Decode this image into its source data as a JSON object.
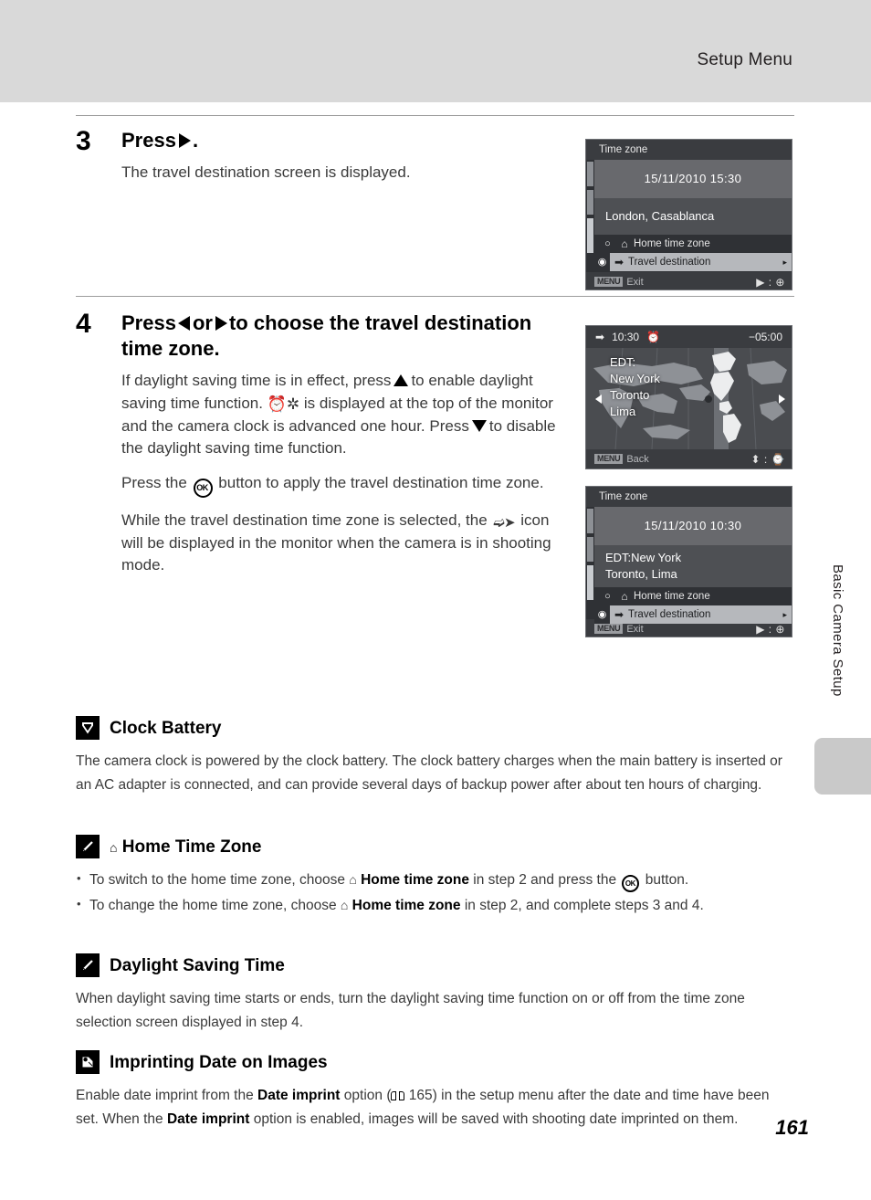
{
  "header": {
    "title": "Setup Menu"
  },
  "side_tab": {
    "label": "Basic Camera Setup"
  },
  "page_number": "161",
  "steps": [
    {
      "number": "3",
      "heading_prefix": "Press",
      "heading_suffix": ".",
      "paragraphs": [
        "The travel destination screen is displayed."
      ]
    },
    {
      "number": "4",
      "heading_part_1": "Press",
      "heading_part_2": "or",
      "heading_part_3": "to choose the travel destination time zone.",
      "para_1_a": "If daylight saving time is in effect, press",
      "para_1_b": "to enable daylight saving time function.",
      "para_1_c": "is displayed at the top of the monitor and the camera clock is advanced one hour. Press",
      "para_1_d": "to disable the daylight saving time function.",
      "para_2_a": "Press the",
      "para_2_b": "button to apply the travel destination time zone.",
      "para_3_a": "While the travel destination time zone is selected, the",
      "para_3_b": "icon will be displayed in the monitor when the camera is in shooting mode."
    }
  ],
  "lcd_screens": [
    {
      "title": "Time zone",
      "date": "15/11/2010 15:30",
      "city_lines": [
        "London, Casablanca"
      ],
      "options": [
        {
          "radio": "○",
          "icon": "home-icon",
          "label": "Home time zone",
          "selected": false
        },
        {
          "radio": "◉",
          "icon": "airplane-icon",
          "label": "Travel destination",
          "selected": true
        }
      ],
      "bottom_left_badge": "MENU",
      "bottom_left_label": "Exit",
      "bottom_right": "▶ : ⊕"
    },
    {
      "top_left_icon": "airplane-icon",
      "time": "10:30",
      "dst_icon": "daylight-saving-icon",
      "utc_offset": "−05:00",
      "labels": [
        "EDT:",
        "New York",
        "Toronto",
        "Lima"
      ],
      "bottom_left_badge": "MENU",
      "bottom_left_label": "Back",
      "bottom_right": "⬍ : ⌚"
    },
    {
      "title": "Time zone",
      "date": "15/11/2010 10:30",
      "city_lines": [
        "EDT:New York",
        "Toronto, Lima"
      ],
      "options": [
        {
          "radio": "○",
          "icon": "home-icon",
          "label": "Home time zone",
          "selected": false
        },
        {
          "radio": "◉",
          "icon": "airplane-icon",
          "label": "Travel destination",
          "selected": true
        }
      ],
      "bottom_left_badge": "MENU",
      "bottom_left_label": "Exit",
      "bottom_right": "▶ : ⊕"
    }
  ],
  "notes": [
    {
      "badge": "caution-icon",
      "title": "Clock Battery",
      "body": "The camera clock is powered by the clock battery. The clock battery charges when the main battery is inserted or an AC adapter is connected, and can provide several days of backup power after about ten hours of charging."
    },
    {
      "badge": "pencil-icon",
      "title": "Home Time Zone",
      "bullet_1_a": "To switch to the home time zone, choose",
      "bullet_1_b": "Home time zone",
      "bullet_1_c": "in step 2 and press the",
      "bullet_1_d": "button.",
      "bullet_2_a": "To change the home time zone, choose",
      "bullet_2_b": "Home time zone",
      "bullet_2_c": "in step 2, and complete steps 3 and 4."
    },
    {
      "badge": "pencil-icon",
      "title": "Daylight Saving Time",
      "body": "When daylight saving time starts or ends, turn the daylight saving time function on or off from the time zone selection screen displayed in step 4."
    },
    {
      "badge": "date-imprint-icon",
      "title": "Imprinting Date on Images",
      "body_a": "Enable date imprint from the",
      "body_b": "Date imprint",
      "body_c": "option (",
      "body_d": "165) in the setup menu after the date and time have been set. When the",
      "body_e": "Date imprint",
      "body_f": "option is enabled, images will be saved with shooting date imprinted on them."
    }
  ],
  "colors": {
    "header_band": "#d9d9d9",
    "lcd_body": "#2f3135",
    "lcd_highlight": "#b6b8bc",
    "side_tab": "#c9c9c9"
  }
}
